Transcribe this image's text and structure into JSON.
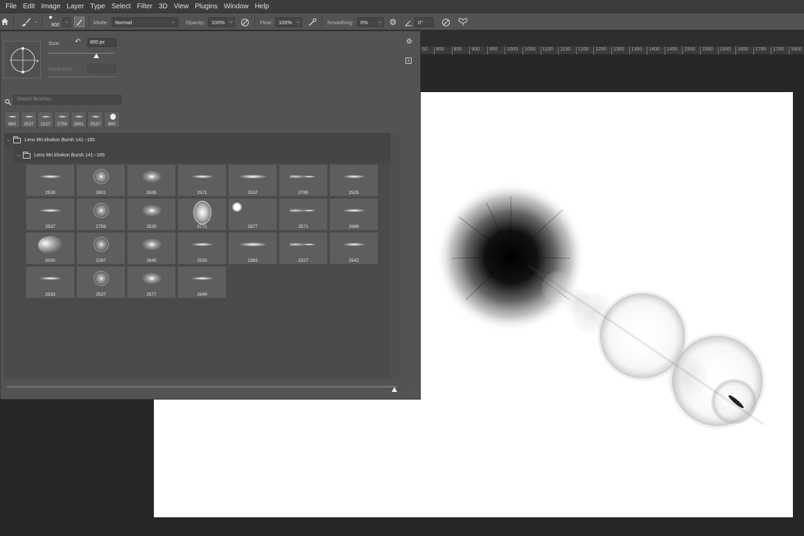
{
  "menu": [
    "File",
    "Edit",
    "Image",
    "Layer",
    "Type",
    "Select",
    "Filter",
    "3D",
    "View",
    "Plugins",
    "Window",
    "Help"
  ],
  "options": {
    "brush_size": "800",
    "mode_label": "Mode:",
    "mode_value": "Normal",
    "opacity_label": "Opacity:",
    "opacity_value": "100%",
    "flow_label": "Flow:",
    "flow_value": "100%",
    "smoothing_label": "Smoothing:",
    "smoothing_value": "0%",
    "angle_value": "0°"
  },
  "ruler": [
    "50",
    "800",
    "850",
    "900",
    "950",
    "1000",
    "1050",
    "1100",
    "1150",
    "1200",
    "1250",
    "1300",
    "1350",
    "1400",
    "1450",
    "1500",
    "1550",
    "1600",
    "1650",
    "1700",
    "1750",
    "1800"
  ],
  "panel": {
    "size_label": "Size:",
    "size_value": "800 px",
    "size_slider": 0.72,
    "hardness_label": "Hardness:",
    "search_placeholder": "Search Brushes",
    "recent": [
      "800",
      "2537",
      "2227",
      "2759",
      "2601",
      "2537",
      "600"
    ],
    "group_name": "Lens Mri khokon Bursh 141--165",
    "subgroup_name": "Lens Mri khokon Bursh 141--165",
    "brushes": [
      [
        "2539",
        "2601",
        "2635",
        "2571",
        "2537",
        "2799",
        "2525"
      ],
      [
        "2537",
        "2759",
        "2535",
        "3771",
        "2877",
        "2571",
        "2686"
      ],
      [
        "3000",
        "2287",
        "2645",
        "2533",
        "2383",
        "2227",
        "2542"
      ],
      [
        "2533",
        "2537",
        "2577",
        "2649"
      ]
    ]
  }
}
